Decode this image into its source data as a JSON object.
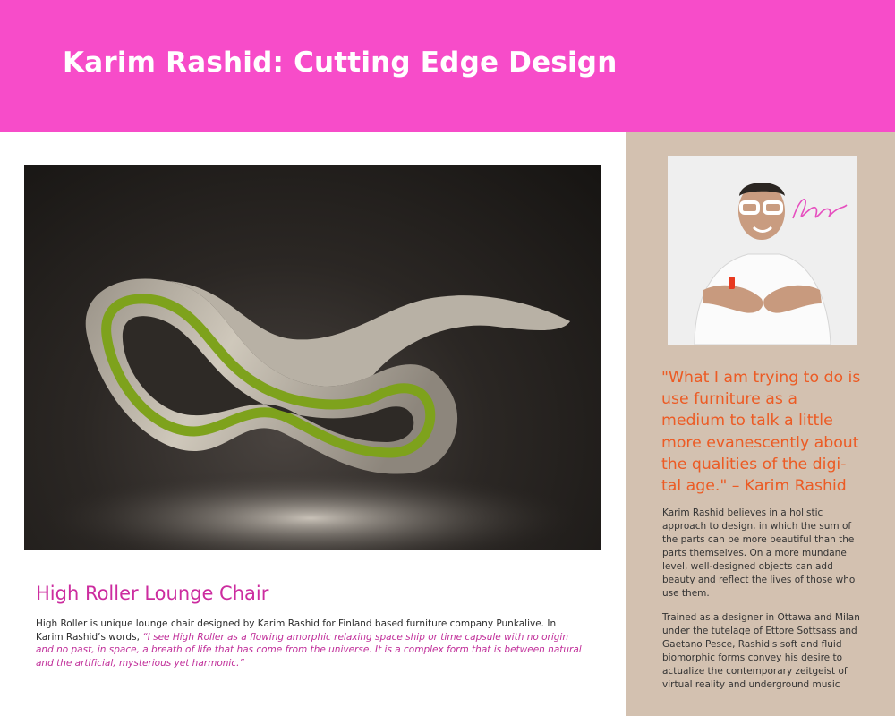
{
  "header": {
    "title": "Karim Rashid: Cutting Edge Design",
    "bg_color": "#f74cc9"
  },
  "main": {
    "photo": {
      "subject": "lounge-chair-photo"
    },
    "section_title": "High Roller Lounge Chair",
    "body_intro": "High Roller is unique lounge chair designed by Karim Rashid for Finland based furniture company Punkalive. In Karim Rashid’s words, ",
    "body_quote": "“I see High Roller as a flowing amorphic relaxing space ship or time capsule with no origin and no past, in space, a breath of life that has come from the universe. It is a complex form that is between natural and the artificial, mysterious yet harmonic.”"
  },
  "sidebar": {
    "bg_color": "#d3c1b0",
    "portrait": {
      "subject": "karim-rashid-portrait"
    },
    "quote_lines": [
      "\"What I am trying to do is",
      "use furniture as a",
      "medium to talk a little",
      "more evanescently about",
      "the qualities of the digi-",
      "tal age.\" – Karim Rashid"
    ],
    "para1_lines": [
      "Karim Rashid believes in a holistic",
      "approach to design, in which the sum of",
      "the parts can be more beautiful than the",
      "parts themselves. On a more mundane",
      "level, well-designed objects can add",
      "beauty and reflect the lives of those who",
      "use them."
    ],
    "para2_lines": [
      "Trained as a designer in Ottawa and Milan",
      "under the tutelage of Ettore Sottsass and",
      "Gaetano Pesce, Rashid's soft and fluid",
      "biomorphic forms convey his desire to",
      "actualize the contemporary zeitgeist of",
      "virtual reality and underground music"
    ]
  }
}
